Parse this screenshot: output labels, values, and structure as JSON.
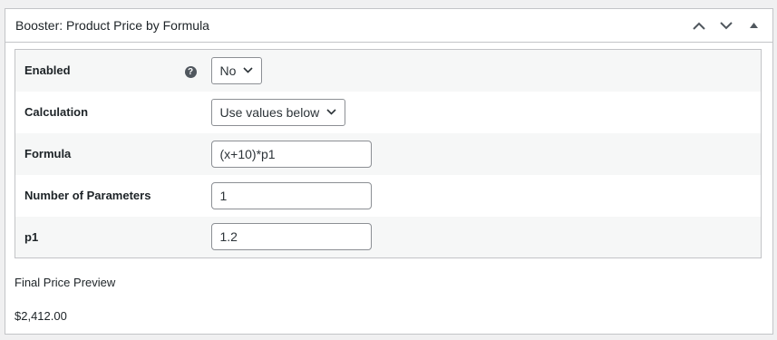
{
  "metabox": {
    "title": "Booster: Product Price by Formula",
    "move_up_label": "Move up",
    "move_down_label": "Move down",
    "toggle_label": "Toggle panel"
  },
  "settings": {
    "enabled": {
      "label": "Enabled",
      "help_icon": "question-circle-icon",
      "value": "No"
    },
    "calculation": {
      "label": "Calculation",
      "value": "Use values below"
    },
    "formula": {
      "label": "Formula",
      "value": "(x+10)*p1"
    },
    "num_params": {
      "label": "Number of Parameters",
      "value": "1"
    },
    "p1": {
      "label": "p1",
      "value": "1.2"
    }
  },
  "preview": {
    "label": "Final Price Preview",
    "value": "$2,412.00"
  },
  "colors": {
    "background": "#f0f0f1",
    "panel": "#ffffff",
    "border": "#c3c4c7",
    "row_alt": "#f6f7f7",
    "text": "#1d2327",
    "icon": "#50575e"
  }
}
